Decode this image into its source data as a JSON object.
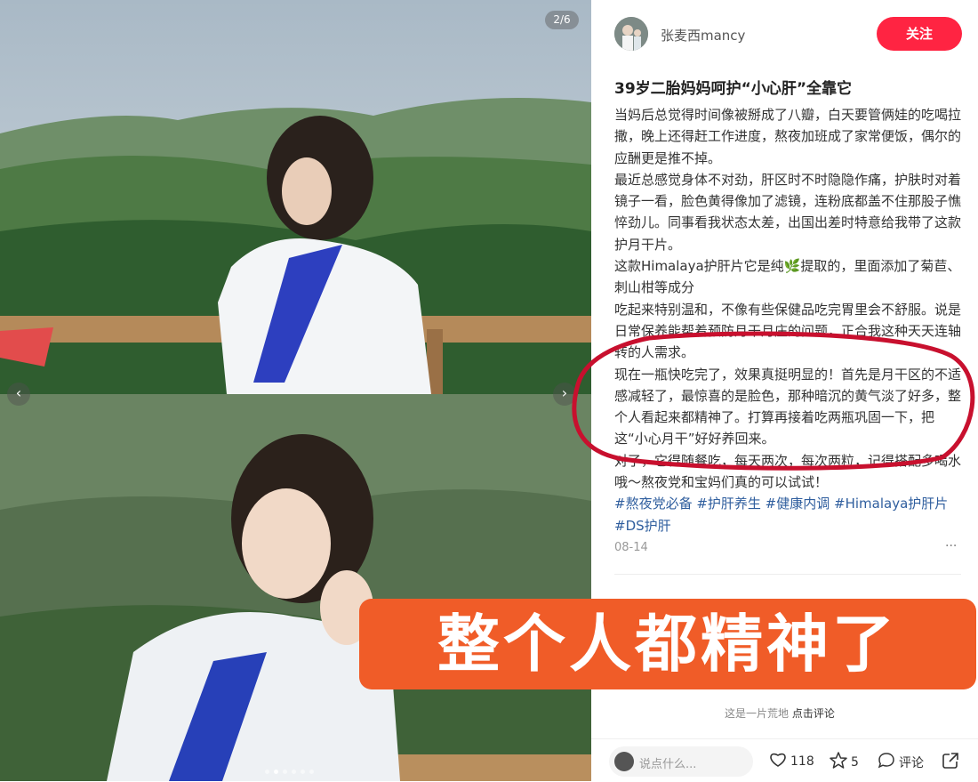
{
  "gallery": {
    "counter": "2/6",
    "prev_label": "‹",
    "next_label": "›",
    "dot_count": 6,
    "active_dot": 1
  },
  "author": {
    "name": "张麦西mancy",
    "follow_label": "关注"
  },
  "post": {
    "title": "39岁二胎妈妈呵护“小心肝”全靠它",
    "paragraphs": [
      "当妈后总觉得时间像被掰成了八瓣，白天要管俩娃的吃喝拉撒，晚上还得赶工作进度，熬夜加班成了家常便饭，偶尔的应酬更是推不掉。",
      "最近总感觉身体不对劲，肝区时不时隐隐作痛，护肤时对着镜子一看，脸色黄得像加了滤镜，连粉底都盖不住那股子憔悴劲儿。同事看我状态太差，出国出差时特意给我带了这款护月干片。",
      "这款Himalaya护肝片它是纯🌿提取的，里面添加了菊苣、刺山柑等成分",
      "吃起来特别温和，不像有些保健品吃完胃里会不舒服。说是日常保养能帮着预防月干月庄的问题，正合我这种天天连轴转的人需求。",
      "现在一瓶快吃完了，效果真挺明显的！首先是月干区的不适感减轻了，最惊喜的是脸色，那种暗沉的黄气淡了好多，整个人看起来都精神了。打算再接着吃两瓶巩固一下，把这“小心月干”好好养回来。",
      "对了，它得随餐吃，每天两次，每次两粒，记得搭配多喝水哦～熬夜党和宝妈们真的可以试试！"
    ],
    "tags": "#熬夜党必备 #护肝养生 #健康内调 #Himalaya护肝片 #DS护肝",
    "date": "08-14",
    "more_label": "···"
  },
  "comments": {
    "empty_text": "这是一片荒地",
    "cta": "点击评论",
    "input_placeholder": "说点什么..."
  },
  "actions": {
    "likes": "118",
    "stars": "5",
    "comment_label": "评论"
  },
  "overlay": {
    "banner_text": "整个人都精神了",
    "banner_color": "#f05c28",
    "circle_color": "#c8102e"
  }
}
